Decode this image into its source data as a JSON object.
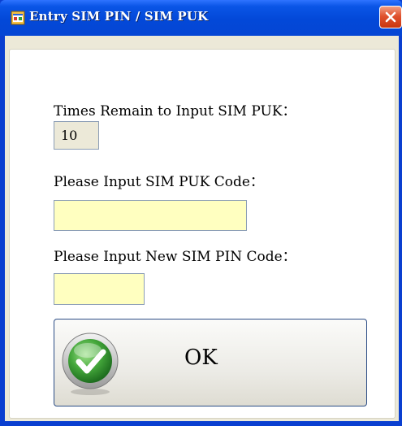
{
  "window": {
    "title": "Entry SIM PIN / SIM PUK",
    "icon": "app-window-icon",
    "close_icon": "close-icon"
  },
  "form": {
    "times_remain_label": "Times Remain to Input SIM PUK：",
    "times_remain_value": "10",
    "puk_label": "Please Input SIM PUK Code：",
    "puk_value": "",
    "new_pin_label": "Please Input New SIM PIN Code：",
    "new_pin_value": ""
  },
  "ok_button": {
    "label": "OK",
    "icon": "checkmark-icon"
  },
  "colors": {
    "titlebar": "#0348d8",
    "input_background": "#ffffc0",
    "dialog_background": "#ece9d8"
  }
}
